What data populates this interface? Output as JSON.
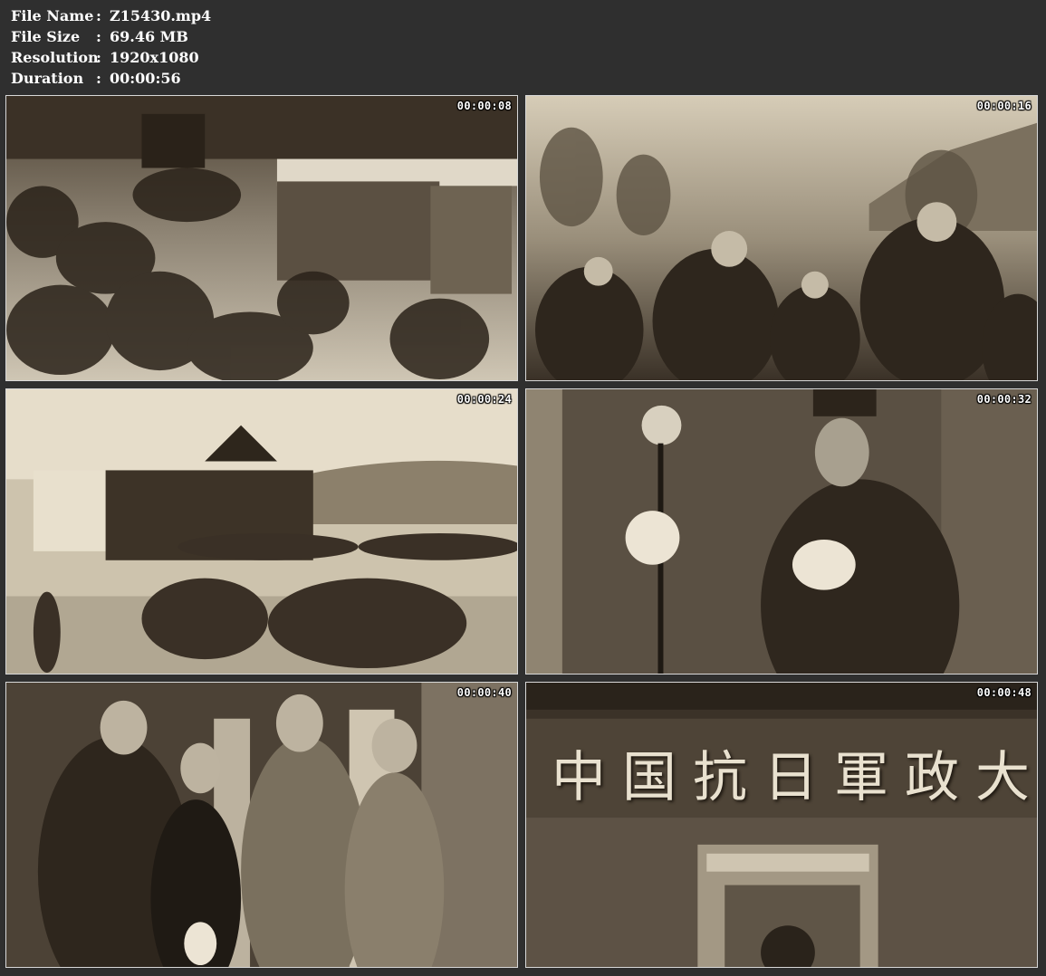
{
  "file_info": {
    "rows": [
      {
        "label": "File Name",
        "sep": ":",
        "value": "Z15430.mp4"
      },
      {
        "label": "File Size",
        "sep": ":",
        "value": "69.46 MB"
      },
      {
        "label": "Resolution",
        "sep": ":",
        "value": "1920x1080"
      },
      {
        "label": "Duration",
        "sep": ":",
        "value": "00:00:56"
      }
    ]
  },
  "thumbnails": [
    {
      "timestamp": "00:00:08",
      "scene": "soldiers-crouching-in-snow"
    },
    {
      "timestamp": "00:00:16",
      "scene": "soldiers-marching-with-rifles"
    },
    {
      "timestamp": "00:00:24",
      "scene": "troops-parade-before-building"
    },
    {
      "timestamp": "00:00:32",
      "scene": "officer-speaking-at-microphone"
    },
    {
      "timestamp": "00:00:40",
      "scene": "officers-and-woman-standing"
    },
    {
      "timestamp": "00:00:48",
      "scene": "gate-with-chinese-banner",
      "banner_text": "中国抗日軍政大"
    }
  ],
  "colors": {
    "background": "#2f2f2f",
    "text": "#ffffff",
    "sepia_dark": "#2a2219",
    "sepia_light": "#d9cfbc"
  }
}
